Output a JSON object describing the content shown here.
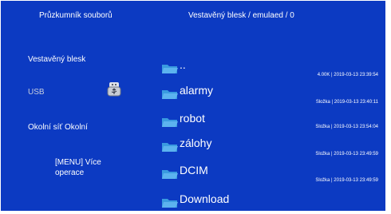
{
  "header": {
    "left_title": "Průzkumník souborů",
    "path_title": "Vestavěný blesk / emulaed / 0"
  },
  "sidebar": {
    "items": [
      {
        "label": "Vestavěný blesk"
      },
      {
        "label": "USB"
      },
      {
        "label": "Okolní síť Okolní"
      }
    ],
    "more_line1": "[MENU] Více",
    "more_line2": "operace"
  },
  "files": [
    {
      "name": "..",
      "meta": "4.00K | 2019-03-13 23:39:54",
      "icon": "folder-up-icon"
    },
    {
      "name": "alarmy",
      "meta": "Složka | 2019-03-13 23:40:11",
      "icon": "folder-icon"
    },
    {
      "name": "robot",
      "meta": "Složka | 2019-03-13 23:54:04",
      "icon": "folder-icon"
    },
    {
      "name": "zálohy",
      "meta": "Složka | 2019-03-13 23:49:59",
      "icon": "folder-icon"
    },
    {
      "name": "DCIM",
      "meta": "Složka | 2019-03-13 23:49:59",
      "icon": "folder-icon"
    },
    {
      "name": "Download",
      "meta": "",
      "icon": "folder-icon"
    }
  ],
  "colors": {
    "background": "#0c3ac2",
    "folder": "#3a9be0",
    "text": "#ffffff"
  }
}
